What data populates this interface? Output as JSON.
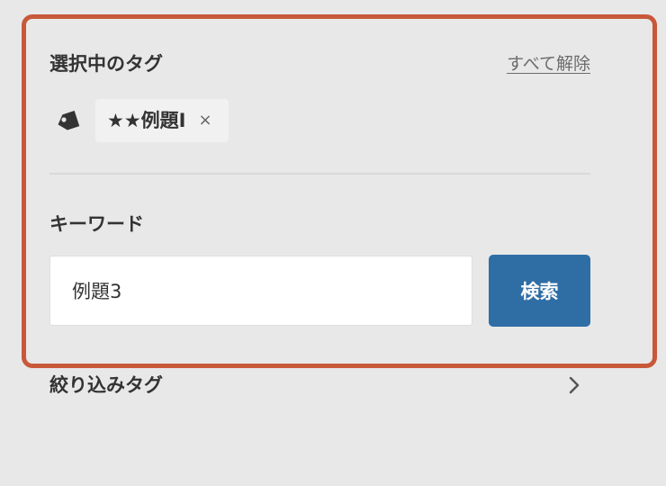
{
  "selected_tags_section": {
    "title": "選択中のタグ",
    "clear_all_label": "すべて解除",
    "tags": [
      {
        "label": "★★例題Ⅰ",
        "remove_symbol": "×"
      }
    ]
  },
  "keyword_section": {
    "label": "キーワード",
    "input_value": "例題3",
    "search_button_label": "検索"
  },
  "filter_tags": {
    "label": "絞り込みタグ"
  },
  "icons": {
    "tag": "tag-icon",
    "chevron": "chevron-right-icon"
  },
  "colors": {
    "highlight_border": "#c8583a",
    "primary_button": "#2f6ea5",
    "page_background": "#e8e8e8",
    "chip_background": "#f1f1f1"
  }
}
